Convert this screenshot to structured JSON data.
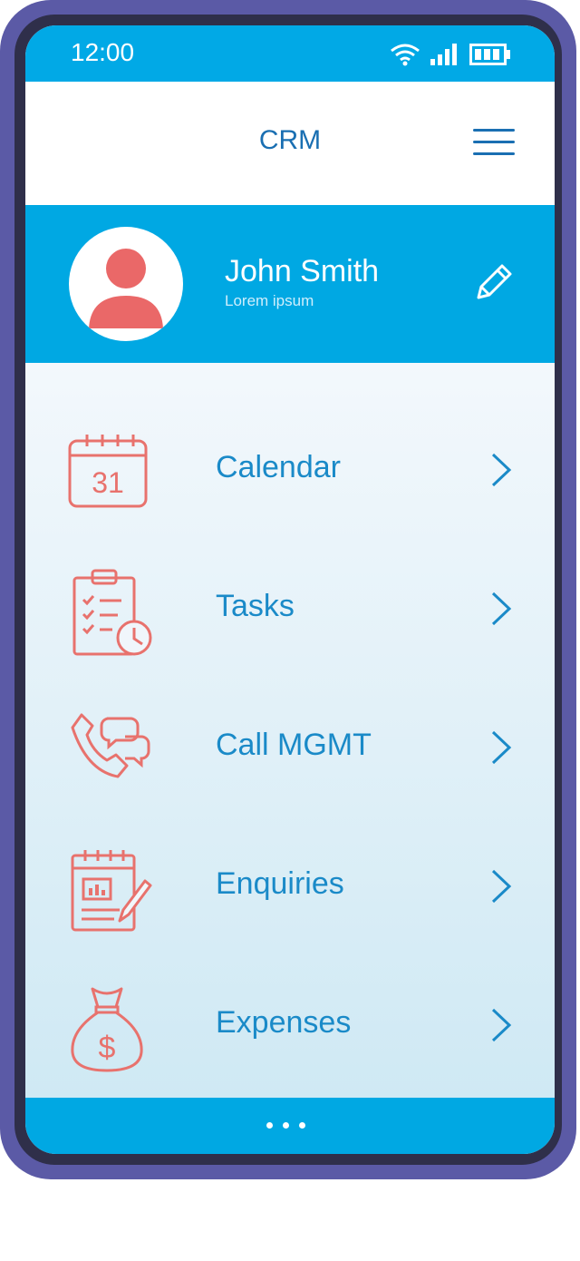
{
  "status_bar": {
    "time": "12:00"
  },
  "header": {
    "title": "CRM",
    "menu_icon": "hamburger-menu-icon"
  },
  "profile": {
    "name": "John Smith",
    "subtitle": "Lorem ipsum",
    "edit_icon": "pencil-icon"
  },
  "menu": {
    "items": [
      {
        "label": "Calendar",
        "icon": "calendar-icon",
        "date": "31"
      },
      {
        "label": "Tasks",
        "icon": "clipboard-clock-icon"
      },
      {
        "label": "Call MGMT",
        "icon": "phone-chat-icon"
      },
      {
        "label": "Enquiries",
        "icon": "notepad-pencil-icon"
      },
      {
        "label": "Expenses",
        "icon": "money-bag-icon",
        "symbol": "$"
      }
    ]
  },
  "colors": {
    "frame": "#5b5aa6",
    "accent": "#00a8e3",
    "text_accent": "#1a8ac8",
    "icon_stroke": "#e8726d"
  }
}
